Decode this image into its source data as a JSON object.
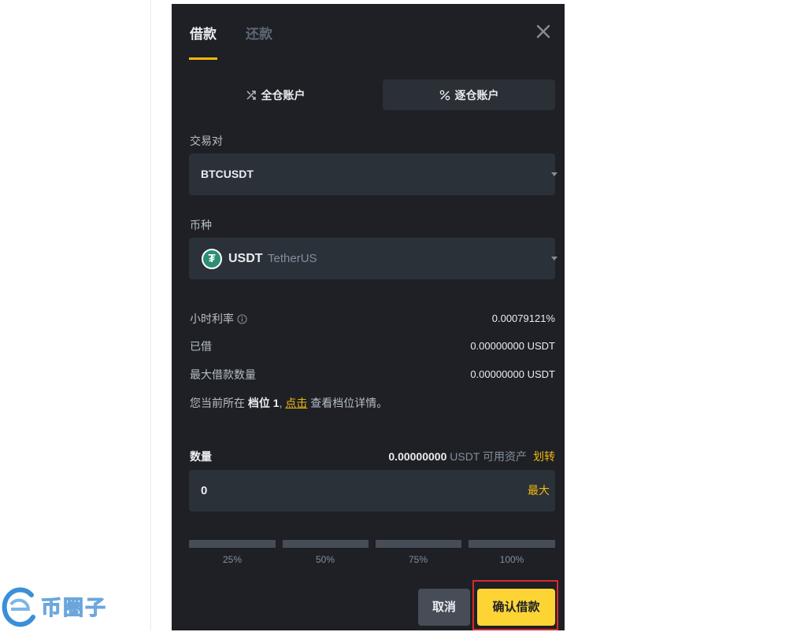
{
  "modal": {
    "tabs": [
      {
        "label": "借款",
        "active": true
      },
      {
        "label": "还款",
        "active": false
      }
    ],
    "close_icon": "close-icon",
    "account_modes": [
      {
        "label": "全仓账户",
        "icon": "cross-margin-icon",
        "active": false
      },
      {
        "label": "逐仓账户",
        "icon": "isolated-margin-icon",
        "active": true
      }
    ],
    "pair": {
      "label": "交易对",
      "value": "BTCUSDT"
    },
    "coin": {
      "label": "币种",
      "symbol": "USDT",
      "name": "TetherUS",
      "icon": "tether-icon"
    },
    "info": [
      {
        "label": "小时利率",
        "value": "0.00079121%",
        "icon": "info-icon"
      },
      {
        "label": "已借",
        "value": "0.00000000 USDT"
      },
      {
        "label": "最大借款数量",
        "value": "0.00000000 USDT"
      }
    ],
    "tier_note": {
      "prefix": "您当前所在 ",
      "tier": "档位 1",
      "sep": ", ",
      "link": "点击",
      "suffix": " 查看档位详情。"
    },
    "amount": {
      "label": "数量",
      "available_value": "0.00000000",
      "available_unit": " USDT 可用资产",
      "transfer": "划转",
      "input_value": "0",
      "max": "最大"
    },
    "percent_options": [
      "25%",
      "50%",
      "75%",
      "100%"
    ],
    "buttons": {
      "cancel": "取消",
      "confirm": "确认借款"
    }
  },
  "watermark": {
    "text": "币圈子"
  },
  "colors": {
    "modal_bg": "#1e2026",
    "field_bg": "#2b3139",
    "accent": "#f0b90b",
    "confirm_button": "#fcd535",
    "highlight_outline": "#d92b2b"
  }
}
